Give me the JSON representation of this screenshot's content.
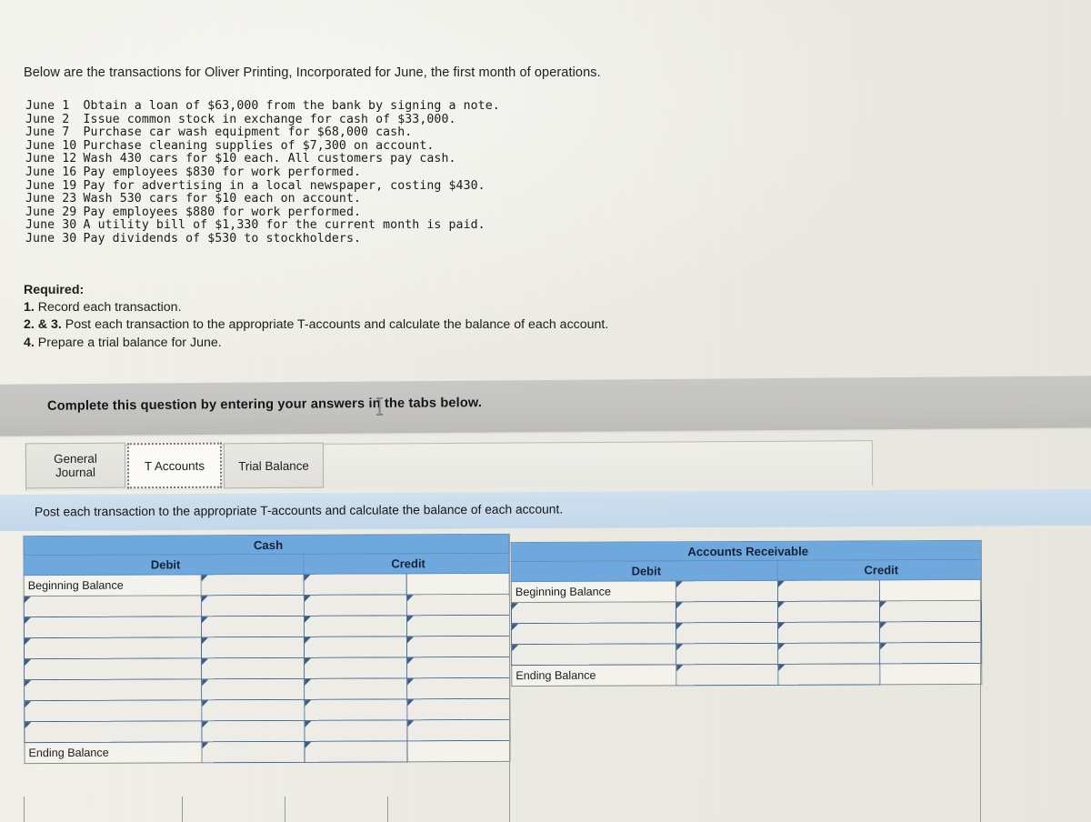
{
  "intro": "Below are the transactions for Oliver Printing, Incorporated for June, the first month of operations.",
  "transactions": [
    {
      "date": "June 1",
      "text": "Obtain a loan of $63,000 from the bank by signing a note."
    },
    {
      "date": "June 2",
      "text": "Issue common stock in exchange for cash of $33,000."
    },
    {
      "date": "June 7",
      "text": "Purchase car wash equipment for $68,000 cash."
    },
    {
      "date": "June 10",
      "text": "Purchase cleaning supplies of $7,300 on account."
    },
    {
      "date": "June 12",
      "text": "Wash 430 cars for $10 each. All customers pay cash."
    },
    {
      "date": "June 16",
      "text": "Pay employees $830 for work performed."
    },
    {
      "date": "June 19",
      "text": "Pay for advertising in a local newspaper, costing $430."
    },
    {
      "date": "June 23",
      "text": "Wash 530 cars for $10 each on account."
    },
    {
      "date": "June 29",
      "text": "Pay employees $880 for work performed."
    },
    {
      "date": "June 30",
      "text": "A utility bill of $1,330 for the current month is paid."
    },
    {
      "date": "June 30",
      "text": "Pay dividends of $530 to stockholders."
    }
  ],
  "required": {
    "heading": "Required:",
    "items": [
      {
        "num": "1.",
        "text": " Record each transaction."
      },
      {
        "num": "2. & 3.",
        "text": " Post each transaction to the appropriate T-accounts and calculate the balance of each account."
      },
      {
        "num": "4.",
        "text": " Prepare a trial balance for June."
      }
    ]
  },
  "banner": {
    "text": "Complete this question by entering your answers in the tabs below."
  },
  "tabs": [
    {
      "label": "General Journal",
      "line1": "General",
      "line2": "Journal",
      "active": false
    },
    {
      "label": "T Accounts",
      "line1": "T Accounts",
      "line2": "",
      "active": true
    },
    {
      "label": "Trial Balance",
      "line1": "Trial Balance",
      "line2": "",
      "active": false
    }
  ],
  "instruction": "Post each transaction to the appropriate T-accounts and calculate the balance of each account.",
  "accounts": [
    {
      "title": "Cash",
      "debit_header": "Debit",
      "credit_header": "Credit",
      "beginning_label": "Beginning Balance",
      "ending_label": "Ending Balance",
      "blank_rows": 7,
      "rows": [
        {
          "debit_label": "Beginning Balance",
          "debit_value": "",
          "credit_label": "",
          "credit_value": ""
        },
        {
          "debit_label": "",
          "debit_value": "",
          "credit_label": "",
          "credit_value": ""
        },
        {
          "debit_label": "",
          "debit_value": "",
          "credit_label": "",
          "credit_value": ""
        },
        {
          "debit_label": "",
          "debit_value": "",
          "credit_label": "",
          "credit_value": ""
        },
        {
          "debit_label": "",
          "debit_value": "",
          "credit_label": "",
          "credit_value": ""
        },
        {
          "debit_label": "",
          "debit_value": "",
          "credit_label": "",
          "credit_value": ""
        },
        {
          "debit_label": "",
          "debit_value": "",
          "credit_label": "",
          "credit_value": ""
        },
        {
          "debit_label": "",
          "debit_value": "",
          "credit_label": "",
          "credit_value": ""
        },
        {
          "debit_label": "Ending Balance",
          "debit_value": "",
          "credit_label": "",
          "credit_value": ""
        }
      ]
    },
    {
      "title": "Accounts Receivable",
      "debit_header": "Debit",
      "credit_header": "Credit",
      "beginning_label": "Beginning Balance",
      "ending_label": "Ending Balance",
      "blank_rows": 3,
      "rows": [
        {
          "debit_label": "Beginning Balance",
          "debit_value": "",
          "credit_label": "",
          "credit_value": ""
        },
        {
          "debit_label": "",
          "debit_value": "",
          "credit_label": "",
          "credit_value": ""
        },
        {
          "debit_label": "",
          "debit_value": "",
          "credit_label": "",
          "credit_value": ""
        },
        {
          "debit_label": "",
          "debit_value": "",
          "credit_label": "",
          "credit_value": ""
        },
        {
          "debit_label": "Ending Balance",
          "debit_value": "",
          "credit_label": "",
          "credit_value": ""
        }
      ]
    }
  ],
  "colors": {
    "header_blue": "#6ea8dc",
    "band_blue": "#c9dcec",
    "banner_gray": "#c6c5c2",
    "page_bg": "#efeee7",
    "input_border": "#49688c"
  }
}
